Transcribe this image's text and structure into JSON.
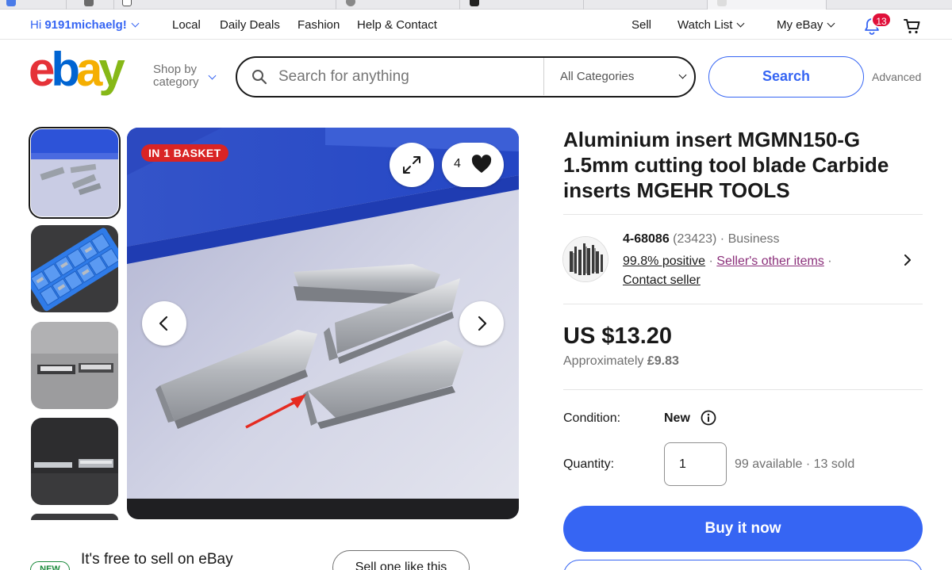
{
  "colors": {
    "accent": "#3665f3",
    "badge": "#e0103a",
    "basket": "#d92424",
    "visited_link": "#8b2f7a",
    "new_green": "#1a8a3b"
  },
  "topnav": {
    "greeting": "Hi",
    "username": "9191michaelg!",
    "links": [
      "Local",
      "Daily Deals",
      "Fashion",
      "Help & Contact"
    ],
    "sell": "Sell",
    "watch_list": "Watch List",
    "my_ebay": "My eBay",
    "notification_count": "13",
    "icons": [
      "bell-icon",
      "cart-icon"
    ]
  },
  "header": {
    "logo_text": "ebay",
    "shop_by": "Shop by",
    "category": "category",
    "search_placeholder": "Search for anything",
    "category_select": "All Categories",
    "search_button": "Search",
    "advanced": "Advanced"
  },
  "gallery": {
    "badge": "IN 1 BASKET",
    "watch_count": "4",
    "thumbnails_visible": 5,
    "selected_index": 0
  },
  "listing": {
    "title": "Aluminium insert MGMN150-G 1.5mm cutting tool blade Carbide inserts MGEHR TOOLS",
    "seller": {
      "name": "4-68086",
      "feedback_count": "(23423)",
      "type": "Business",
      "positive": "99.8% positive",
      "other_items": "Seller's other items",
      "contact": "Contact seller"
    },
    "price": "US $13.20",
    "approx_label": "Approximately",
    "approx_value": "£9.83",
    "condition_label": "Condition:",
    "condition_value": "New",
    "quantity_label": "Quantity:",
    "quantity_value": "1",
    "available": "99 available",
    "sold": "13 sold",
    "buy_now": "Buy it now"
  },
  "sell_banner": {
    "badge": "NEW",
    "text": "It's free to sell on eBay",
    "button": "Sell one like this"
  }
}
